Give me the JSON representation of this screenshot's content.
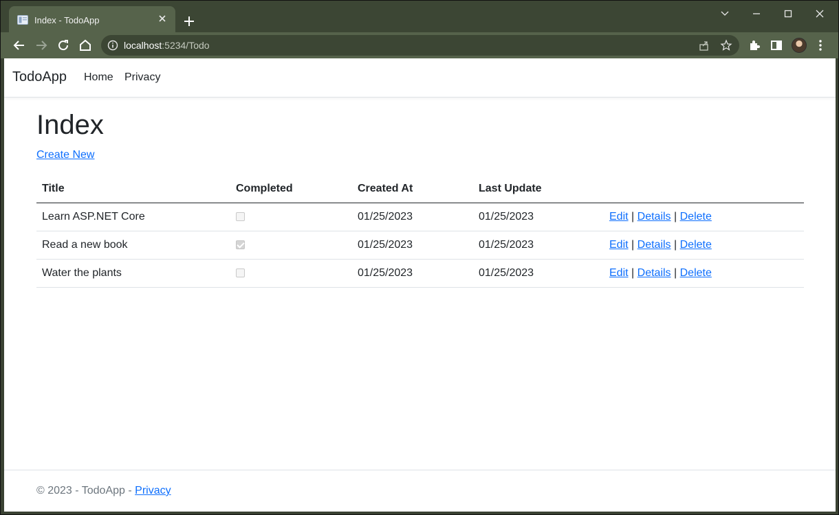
{
  "browser": {
    "tab": {
      "title": "Index - TodoApp"
    },
    "address": {
      "host": "localhost",
      "path": ":5234/Todo"
    }
  },
  "navbar": {
    "brand": "TodoApp",
    "links": [
      "Home",
      "Privacy"
    ]
  },
  "page": {
    "heading": "Index",
    "create_link": "Create New"
  },
  "table": {
    "headers": [
      "Title",
      "Completed",
      "Created At",
      "Last Update"
    ],
    "rows": [
      {
        "title": "Learn ASP.NET Core",
        "completed": false,
        "created_at": "01/25/2023",
        "last_update": "01/25/2023"
      },
      {
        "title": "Read a new book",
        "completed": true,
        "created_at": "01/25/2023",
        "last_update": "01/25/2023"
      },
      {
        "title": "Water the plants",
        "completed": false,
        "created_at": "01/25/2023",
        "last_update": "01/25/2023"
      }
    ],
    "actions": {
      "edit": "Edit",
      "details": "Details",
      "delete": "Delete",
      "separator": "|"
    }
  },
  "footer": {
    "text": "© 2023 - TodoApp - ",
    "link": "Privacy"
  },
  "colors": {
    "link": "#0d6efd",
    "text": "#212529",
    "muted": "#6c757d",
    "chrome_frame": "#3c4634",
    "chrome_toolbar": "#56634b"
  }
}
